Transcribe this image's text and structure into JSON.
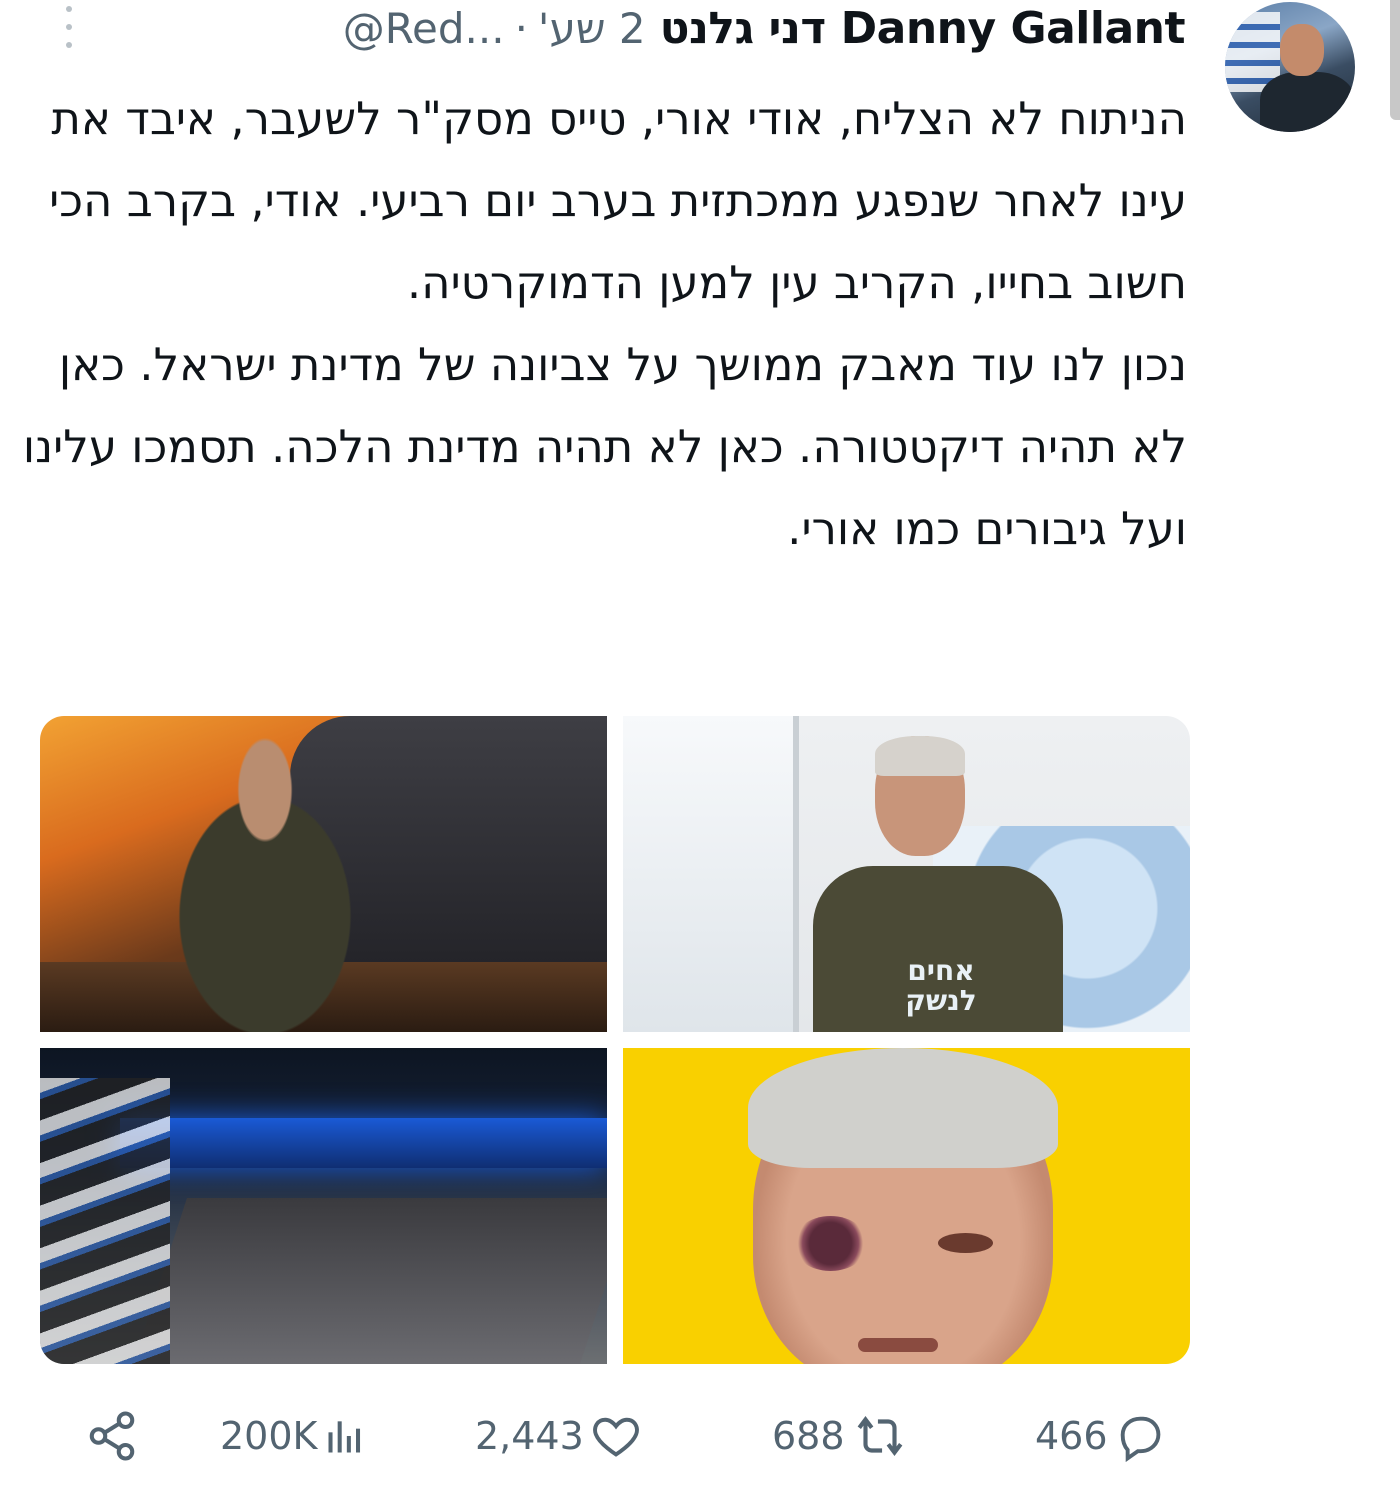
{
  "header": {
    "display_name": "Danny Gallant דני גלנט",
    "handle": "@Red...",
    "separator": "·",
    "time": "2 שע'"
  },
  "tweet": {
    "paragraph1": "הניתוח לא הצליח, אודי אורי, טייס מסק\"ר לשעבר, איבד את עינו לאחר שנפגע ממכתזית בערב יום רביעי. אודי, בקרב הכי חשוב בחייו, הקריב עין למען הדמוקרטיה.",
    "paragraph2": "נכון לנו עוד מאבק ממושך על צביונה של מדינת ישראל. כאן לא תהיה דיקטטורה. כאן לא תהיה מדינת הלכה. תסמכו עלינו ועל גיבורים כמו אורי."
  },
  "media": {
    "shirt_text": "אחים לנשק"
  },
  "actions": {
    "share_icon": "share-icon",
    "views": "200K",
    "likes": "2,443",
    "retweets": "688",
    "replies": "466"
  },
  "colors": {
    "text": "#0f1419",
    "secondary": "#536471",
    "yellow_bg": "#f9d000"
  }
}
